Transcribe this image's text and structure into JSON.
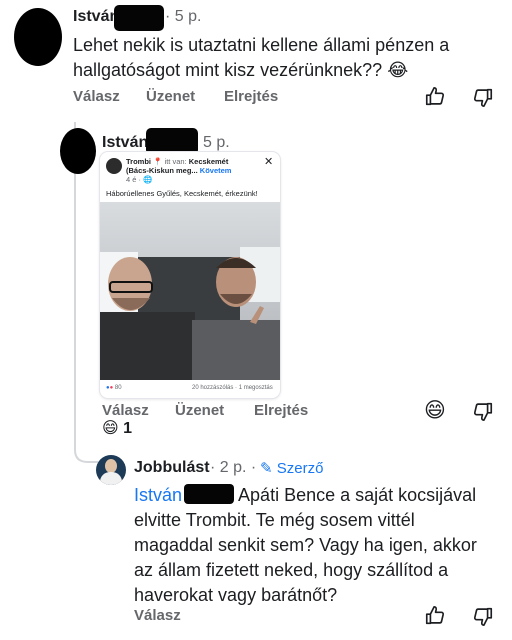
{
  "comment1": {
    "author": "István",
    "time": "· 5 p.",
    "text": "Lehet nekik is utaztatni kellene állami pénzen a hallgatóságot mint kisz vezérünknek??",
    "emoji": "😂",
    "actions": {
      "reply": "Válasz",
      "message": "Üzenet",
      "hide": "Elrejtés"
    }
  },
  "comment2": {
    "author": "István",
    "time": "5 p.",
    "shared_post": {
      "page_name": "Trombi",
      "checkin_prefix": "itt van:",
      "location": "Kecskemét",
      "location_line2": "(Bács-Kiskun meg...",
      "follow": "Követem",
      "meta": "4 é · 🌐",
      "caption": "Háborúellenes Gyűlés, Kecskemét, érkezünk!",
      "reactions_count": "80",
      "stats": "20 hozzászólás · 1 megosztás"
    },
    "actions": {
      "reply": "Válasz",
      "message": "Üzenet",
      "hide": "Elrejtés"
    },
    "reaction_emoji": "😄",
    "reaction_count": "1"
  },
  "reply": {
    "author": "Jobbulást",
    "time": "· 2 p. ·",
    "author_badge": "Szerző",
    "mention": "István",
    "text": " Apáti Bence a saját kocsijával elvitte Trombit. Te még sosem vittél magaddal senkit sem? Vagy ha igen, akkor az állam fizetett neked, hogy szállítod a haverokat vagy barátnőt?",
    "actions": {
      "reply": "Válasz"
    }
  },
  "colors": {
    "link": "#1877f2",
    "muted": "#65676b",
    "text": "#1c1e21"
  }
}
